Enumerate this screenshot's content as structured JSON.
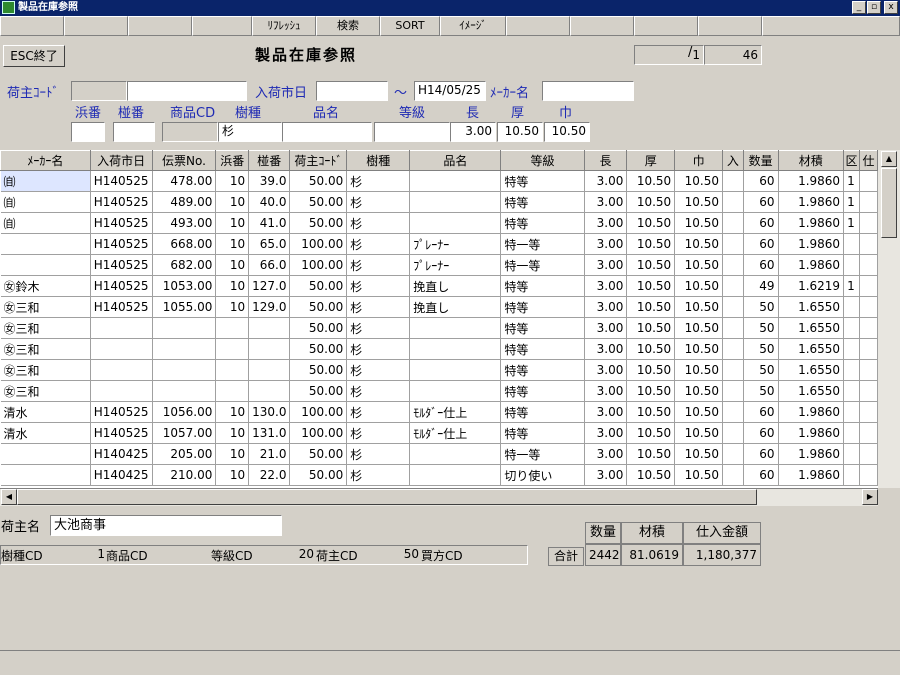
{
  "window": {
    "title": "製品在庫参照",
    "btn_min": "_",
    "btn_max": "▫",
    "btn_close": "x"
  },
  "toolbar": {
    "refresh": "ﾘﾌﾚｯｼｭ",
    "search": "検索",
    "sort": "SORT",
    "image": "ｲﾒｰｼﾞ"
  },
  "header": {
    "esc_label": "ESC終了",
    "title": "製品在庫参照",
    "page_current": "1",
    "page_total": "46"
  },
  "filters": {
    "owner_code_label": "荷主ｺｰﾄﾞ",
    "owner_code_value": "",
    "owner_name_value": "",
    "arrival_market_label": "入荷市日",
    "arrival_from": "",
    "tilde": "～",
    "arrival_to": "H14/05/25",
    "maker_label": "ﾒｰｶｰ名",
    "maker_value": "",
    "hamaban_label": "浜番",
    "hamaban_value": "",
    "zuiban_label": "椪番",
    "zuiban_value": "",
    "product_cd_label": "商品CD",
    "product_cd_value": "",
    "species_label": "樹種",
    "species_value": "杉",
    "product_name_label": "品名",
    "product_name_value": "",
    "grade_label": "等級",
    "grade_value": "",
    "length_label": "長",
    "length_value": "3.00",
    "thickness_label": "厚",
    "thickness_value": "10.50",
    "width_label": "巾",
    "width_value": "10.50"
  },
  "table": {
    "columns": [
      "ﾒｰｶｰ名",
      "入荷市日",
      "伝票No.",
      "浜番",
      "椪番",
      "荷主ｺｰﾄﾞ",
      "樹種",
      "品名",
      "等級",
      "長",
      "厚",
      "巾",
      "入",
      "数量",
      "材積",
      "区",
      "仕"
    ],
    "rows": [
      [
        "㉂",
        "H140525",
        "478.00",
        "10",
        "39.0",
        "50.00",
        "杉",
        "",
        "特等",
        "3.00",
        "10.50",
        "10.50",
        "",
        "60",
        "1.9860",
        "1",
        ""
      ],
      [
        "㉂",
        "H140525",
        "489.00",
        "10",
        "40.0",
        "50.00",
        "杉",
        "",
        "特等",
        "3.00",
        "10.50",
        "10.50",
        "",
        "60",
        "1.9860",
        "1",
        ""
      ],
      [
        "㉂",
        "H140525",
        "493.00",
        "10",
        "41.0",
        "50.00",
        "杉",
        "",
        "特等",
        "3.00",
        "10.50",
        "10.50",
        "",
        "60",
        "1.9860",
        "1",
        ""
      ],
      [
        "",
        "H140525",
        "668.00",
        "10",
        "65.0",
        "100.00",
        "杉",
        "ﾌﾟﾚｰﾅｰ",
        "特一等",
        "3.00",
        "10.50",
        "10.50",
        "",
        "60",
        "1.9860",
        "",
        ""
      ],
      [
        "",
        "H140525",
        "682.00",
        "10",
        "66.0",
        "100.00",
        "杉",
        "ﾌﾟﾚｰﾅｰ",
        "特一等",
        "3.00",
        "10.50",
        "10.50",
        "",
        "60",
        "1.9860",
        "",
        ""
      ],
      [
        "㊛鈴木",
        "H140525",
        "1053.00",
        "10",
        "127.0",
        "50.00",
        "杉",
        "挽直し",
        "特等",
        "3.00",
        "10.50",
        "10.50",
        "",
        "49",
        "1.6219",
        "1",
        ""
      ],
      [
        "㊛三和",
        "H140525",
        "1055.00",
        "10",
        "129.0",
        "50.00",
        "杉",
        "挽直し",
        "特等",
        "3.00",
        "10.50",
        "10.50",
        "",
        "50",
        "1.6550",
        "",
        ""
      ],
      [
        "㊛三和",
        "",
        "",
        "",
        "",
        "50.00",
        "杉",
        "",
        "特等",
        "3.00",
        "10.50",
        "10.50",
        "",
        "50",
        "1.6550",
        "",
        ""
      ],
      [
        "㊛三和",
        "",
        "",
        "",
        "",
        "50.00",
        "杉",
        "",
        "特等",
        "3.00",
        "10.50",
        "10.50",
        "",
        "50",
        "1.6550",
        "",
        ""
      ],
      [
        "㊛三和",
        "",
        "",
        "",
        "",
        "50.00",
        "杉",
        "",
        "特等",
        "3.00",
        "10.50",
        "10.50",
        "",
        "50",
        "1.6550",
        "",
        ""
      ],
      [
        "㊛三和",
        "",
        "",
        "",
        "",
        "50.00",
        "杉",
        "",
        "特等",
        "3.00",
        "10.50",
        "10.50",
        "",
        "50",
        "1.6550",
        "",
        ""
      ],
      [
        "清水",
        "H140525",
        "1056.00",
        "10",
        "130.0",
        "100.00",
        "杉",
        "ﾓﾙﾀﾞｰ仕上",
        "特等",
        "3.00",
        "10.50",
        "10.50",
        "",
        "60",
        "1.9860",
        "",
        ""
      ],
      [
        "清水",
        "H140525",
        "1057.00",
        "10",
        "131.0",
        "100.00",
        "杉",
        "ﾓﾙﾀﾞｰ仕上",
        "特等",
        "3.00",
        "10.50",
        "10.50",
        "",
        "60",
        "1.9860",
        "",
        ""
      ],
      [
        "",
        "H140425",
        "205.00",
        "10",
        "21.0",
        "50.00",
        "杉",
        "",
        "特一等",
        "3.00",
        "10.50",
        "10.50",
        "",
        "60",
        "1.9860",
        "",
        ""
      ],
      [
        "",
        "H140425",
        "210.00",
        "10",
        "22.0",
        "50.00",
        "杉",
        "",
        "切り使い",
        "3.00",
        "10.50",
        "10.50",
        "",
        "60",
        "1.9860",
        "",
        ""
      ]
    ]
  },
  "bottom": {
    "owner_name_label": "荷主名",
    "owner_name_value": "大池商事",
    "species_cd_label": "樹種CD",
    "species_cd_value": "1",
    "product_cd_label": "商品CD",
    "product_cd_value": "",
    "grade_cd_label": "等級CD",
    "grade_cd_value": "20",
    "owner_cd_label": "荷主CD",
    "owner_cd_value": "50",
    "buyer_cd_label": "買方CD",
    "buyer_cd_value": "",
    "total_label": "合計",
    "qty_label": "数量",
    "qty_value": "2442",
    "volume_label": "材積",
    "volume_value": "81.0619",
    "amount_label": "仕入金額",
    "amount_value": "1,180,377"
  },
  "colors": {
    "titlebar": "#0a246a",
    "label_blue": "#1e2ab4",
    "face": "#d4d0c8",
    "selection": "#dde6ff"
  }
}
